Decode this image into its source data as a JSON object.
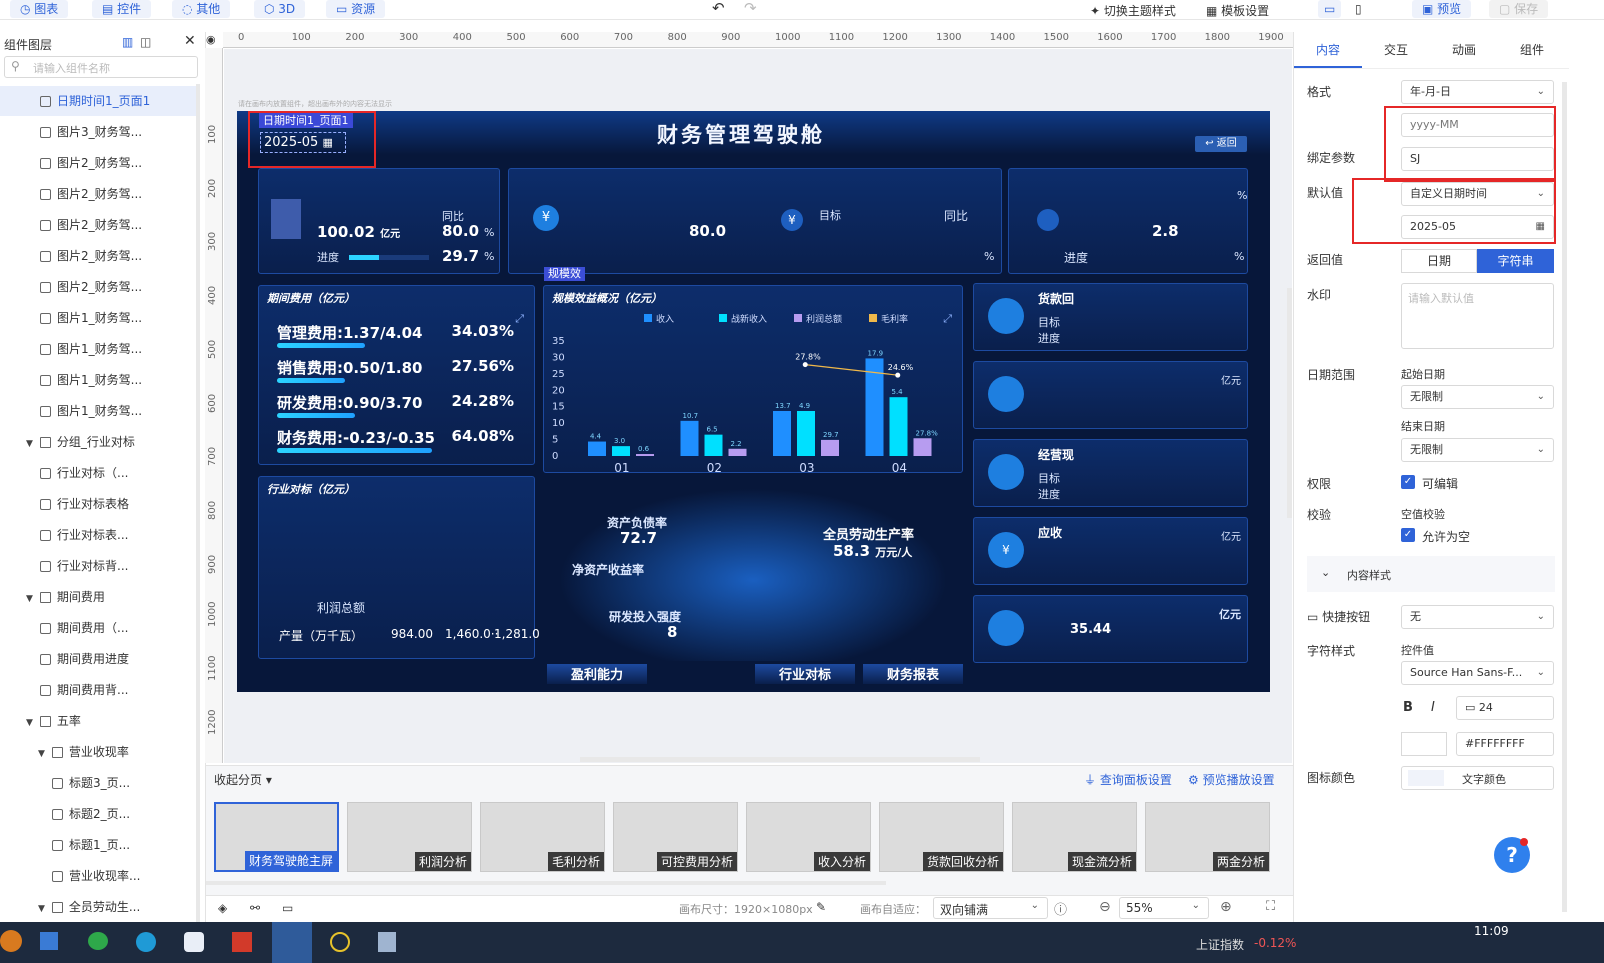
{
  "toolbar": {
    "chart_btn": "图表",
    "control_btn": "控件",
    "other_btn": "其他",
    "threed_btn": "3D",
    "resource_btn": "资源",
    "theme_switch": "切换主题样式",
    "template_settings": "模板设置",
    "preview_btn": "预览",
    "save_btn": "保存"
  },
  "layer_panel": {
    "title": "组件图层",
    "search_placeholder": "请输入组件名称",
    "items": [
      {
        "label": "日期时间1_页面1",
        "selected": true
      },
      {
        "label": "图片3_财务驾..."
      },
      {
        "label": "图片2_财务驾..."
      },
      {
        "label": "图片2_财务驾..."
      },
      {
        "label": "图片2_财务驾..."
      },
      {
        "label": "图片2_财务驾..."
      },
      {
        "label": "图片2_财务驾..."
      },
      {
        "label": "图片1_财务驾..."
      },
      {
        "label": "图片1_财务驾..."
      },
      {
        "label": "图片1_财务驾..."
      },
      {
        "label": "图片1_财务驾..."
      },
      {
        "label": "分组_行业对标"
      },
      {
        "label": "行业对标（..."
      },
      {
        "label": "行业对标表格"
      },
      {
        "label": "行业对标表..."
      },
      {
        "label": "行业对标背..."
      },
      {
        "label": "期间费用"
      },
      {
        "label": "期间费用（..."
      },
      {
        "label": "期间费用进度"
      },
      {
        "label": "期间费用背..."
      },
      {
        "label": "五率"
      },
      {
        "label": "营业收现率"
      },
      {
        "label": "标题3_页..."
      },
      {
        "label": "标题2_页..."
      },
      {
        "label": "标题1_页..."
      },
      {
        "label": "营业收现率..."
      },
      {
        "label": "全员劳动生..."
      }
    ]
  },
  "ruler": {
    "top_ticks": [
      "0",
      "100",
      "200",
      "300",
      "400",
      "500",
      "600",
      "700",
      "800",
      "900",
      "1000",
      "1100",
      "1200",
      "1300",
      "1400",
      "1500",
      "1600",
      "1700",
      "1800",
      "1900"
    ],
    "left_ticks": [
      "100",
      "200",
      "300",
      "400",
      "500",
      "600",
      "700",
      "800",
      "900",
      "1000",
      "1100",
      "1200"
    ]
  },
  "canvas": {
    "hint": "请在画布内放置组件，超出画布外的内容无法显示"
  },
  "dashboard": {
    "title": "财务管理驾驶舱",
    "back_btn": "返回",
    "date_widget_label": "日期时间1_页面1",
    "date_value": "2025-05",
    "kpi1": {
      "value1": "100.02",
      "unit1": "亿元",
      "yoy_label": "同比",
      "yoy": "80.0",
      "pct": "%",
      "progress_label": "进度",
      "progress": "29.7"
    },
    "kpi2": {
      "target_label": "目标",
      "compare_label": "同比",
      "value": "80.0",
      "pct": "%"
    },
    "kpi3": {
      "value": "2.8",
      "pct": "%",
      "progress_label": "进度"
    },
    "cost_card": {
      "title": "期间费用（亿元）",
      "rows": [
        {
          "label": "管理费用:1.37/4.04",
          "pct": "34.03%"
        },
        {
          "label": "销售费用:0.50/1.80",
          "pct": "27.56%"
        },
        {
          "label": "研发费用:0.90/3.70",
          "pct": "24.28%"
        },
        {
          "label": "财务费用:-0.23/-0.35",
          "pct": "64.08%"
        }
      ]
    },
    "profit_card": {
      "title": "规模效益概况（亿元）",
      "scale_tag": "规模效",
      "legend": [
        "收入",
        "战新收入",
        "利润总额",
        "毛利率"
      ]
    },
    "industry_card": {
      "title": "行业对标（亿元）",
      "row_profit": "利润总额",
      "row_output": "产量（万千瓦）",
      "output_values": [
        "984.00",
        "1,460.0··",
        "1,281.0"
      ]
    },
    "five_rates": {
      "debt_label": "资产负债率",
      "debt_value": "72.7",
      "roe_label": "净资产收益率",
      "labor_label": "全员劳动生产率",
      "labor_value": "58.3",
      "labor_unit": "万元/人",
      "invest_label": "研发投入强度",
      "invest_value": "8"
    },
    "right_cards": {
      "ar_title": "货款回",
      "target_label": "目标",
      "progress_label": "进度",
      "card3_title": "经营现",
      "card4_title": "应收",
      "unit_yi": "亿元",
      "last_value": "35.44"
    },
    "bottom_nav": [
      "盈利能力",
      "行业对标",
      "财务报表"
    ]
  },
  "chart_data": {
    "type": "bar",
    "title": "规模效益概况（亿元）",
    "categories": [
      "01",
      "02",
      "03",
      "04"
    ],
    "ylim": [
      0,
      35
    ],
    "y_ticks": [
      "0",
      "5",
      "10",
      "15",
      "20",
      "25",
      "30",
      "35"
    ],
    "series": [
      {
        "name": "收入",
        "values": [
          4.4,
          10.7,
          13.7,
          29.7
        ]
      },
      {
        "name": "战新收入",
        "values": [
          3.0,
          6.5,
          13.7,
          17.9
        ]
      },
      {
        "name": "利润总额",
        "values": [
          0.6,
          2.2,
          4.9,
          5.4
        ]
      },
      {
        "name": "毛利率",
        "values": [
          null,
          null,
          27.8,
          24.6
        ]
      }
    ],
    "data_labels": [
      "4.4",
      "3.0",
      "0.6",
      "10.7",
      "6.5",
      "2.2",
      "13.7",
      "4.9",
      "29.7",
      "17.9",
      "5.4",
      "27.8%",
      "24.6%"
    ]
  },
  "right_panel": {
    "tabs": [
      "内容",
      "交互",
      "动画",
      "组件"
    ],
    "format_label": "格式",
    "format_value": "年-月-日",
    "format_input": "yyyy-MM",
    "bind_param_label": "绑定参数",
    "bind_param_value": "SJ",
    "default_label": "默认值",
    "default_type": "自定义日期时间",
    "default_value": "2025-05",
    "return_label": "返回值",
    "return_date": "日期",
    "return_string": "字符串",
    "watermark_label": "水印",
    "watermark_placeholder": "请输入默认值",
    "date_range_label": "日期范围",
    "start_date_label": "起始日期",
    "start_date_value": "无限制",
    "end_date_label": "结束日期",
    "end_date_value": "无限制",
    "permission_label": "权限",
    "editable_label": "可编辑",
    "validate_label": "校验",
    "empty_check_label": "空值校验",
    "allow_empty_label": "允许为空",
    "content_style_label": "内容样式",
    "shortcut_label": "快捷按钮",
    "shortcut_value": "无",
    "char_style_label": "字符样式",
    "control_value_label": "控件值",
    "font_value": "Source Han Sans-F...",
    "bold": "B",
    "italic": "I",
    "font_size": "24",
    "color_value": "#FFFFFFFF",
    "icon_color_label": "图标颜色",
    "text_color_label": "文字颜色"
  },
  "pages": {
    "collapse_label": "收起分页",
    "query_settings": "查询面板设置",
    "preview_settings": "预览播放设置",
    "thumbs": [
      "财务驾驶舱主屏",
      "利润分析",
      "毛利分析",
      "可控费用分析",
      "收入分析",
      "货款回收分析",
      "现金流分析",
      "两金分析"
    ]
  },
  "status": {
    "canvas_size": "画布尺寸：1920×1080px",
    "adapt_label": "画布自适应：",
    "adapt_value": "双向铺满",
    "zoom": "55%"
  },
  "taskbar": {
    "stock": "上证指数",
    "stock_change": "-0.12%",
    "time": "11:09"
  },
  "colors": {
    "accent": "#2f63d8",
    "dashboard_bg": "#07173a",
    "red_box": "#e52727",
    "bar_cyan": "#00c8ff",
    "bar_blue": "#1f8fff",
    "bar_purple": "#b79cf0"
  }
}
